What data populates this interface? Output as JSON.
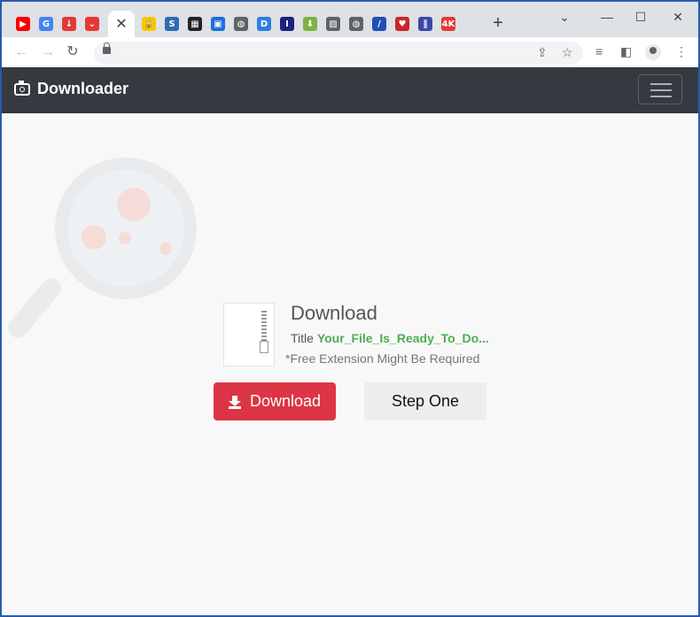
{
  "browser": {
    "tabs": [
      {
        "icon": "youtube-icon",
        "glyph": "▶",
        "color": "#ff0000"
      },
      {
        "icon": "google-icon",
        "glyph": "G",
        "color": "#4285f4"
      },
      {
        "icon": "download-red-icon",
        "glyph": "↓",
        "color": "#e53935"
      },
      {
        "icon": "pocket-icon",
        "glyph": "⌄",
        "color": "#e53935"
      },
      {
        "icon": "lock-yellow-icon",
        "glyph": "🔒",
        "color": "#f9c400"
      },
      {
        "icon": "swirl-icon",
        "glyph": "S",
        "color": "#2c6cb0"
      },
      {
        "icon": "map-icon",
        "glyph": "▦",
        "color": "#222222"
      },
      {
        "icon": "grid-blue-icon",
        "glyph": "▣",
        "color": "#1e6fd9"
      },
      {
        "icon": "globe-icon",
        "glyph": "◍",
        "color": "#5f6368"
      },
      {
        "icon": "blue-d-icon",
        "glyph": "D",
        "color": "#2f7de1"
      },
      {
        "icon": "letter-i-icon",
        "glyph": "I",
        "color": "#1a237e"
      },
      {
        "icon": "green-arrow-icon",
        "glyph": "⬇",
        "color": "#7cb342"
      },
      {
        "icon": "image-icon",
        "glyph": "▨",
        "color": "#5f6368"
      },
      {
        "icon": "globe2-icon",
        "glyph": "◍",
        "color": "#5f6368"
      },
      {
        "icon": "slash-icon",
        "glyph": "/",
        "color": "#1e4fb8"
      },
      {
        "icon": "pocket2-icon",
        "glyph": "♥",
        "color": "#c62828"
      },
      {
        "icon": "stats-icon",
        "glyph": "∥",
        "color": "#3949ab"
      },
      {
        "icon": "4k-icon",
        "glyph": "4K",
        "color": "#e53935"
      }
    ],
    "active_tab_close": "✕",
    "new_tab": "+",
    "window_controls": {
      "minimize": "⌄",
      "min2": "—",
      "maximize": "☐",
      "close": "✕"
    }
  },
  "site": {
    "brand": "Downloader",
    "download_heading": "Download",
    "title_label": "Title",
    "title_value": "Your_File_Is_Ready_To_Do...",
    "note": "*Free Extension Might Be Required",
    "download_button": "Download",
    "step_button": "Step One"
  },
  "colors": {
    "navbar": "#343a40",
    "download_button": "#dc3545",
    "title_value": "#4caf50"
  }
}
